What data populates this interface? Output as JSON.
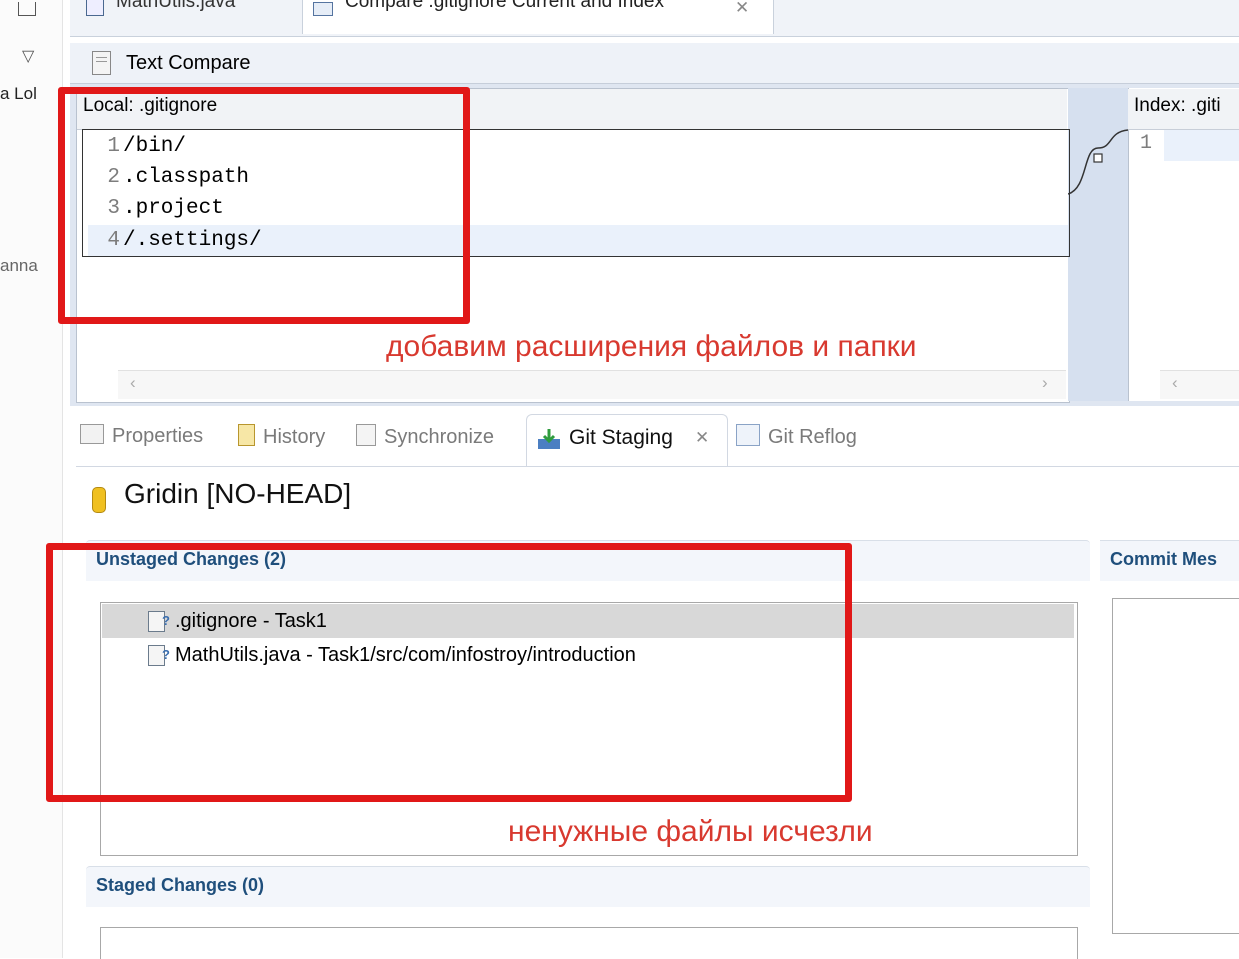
{
  "left_strip": {
    "fragment1": "a Lol",
    "fragment2": "аnna"
  },
  "editor_tabs": [
    {
      "label": "MathUtils.java"
    },
    {
      "label": "Compare .gitignore Current and Index"
    }
  ],
  "compare": {
    "header_title": "Text Compare",
    "left_pane_title": "Local: .gitignore",
    "right_pane_title": "Index: .giti",
    "lines": [
      {
        "num": "1",
        "text": "/bin/"
      },
      {
        "num": "2",
        "text": ".classpath"
      },
      {
        "num": "3",
        "text": ".project"
      },
      {
        "num": "4",
        "text": "/.settings/"
      }
    ],
    "right_lines": [
      {
        "num": "1",
        "text": ""
      }
    ],
    "annotation": "добавим расширения файлов и папки"
  },
  "views_tabs": [
    {
      "label": "Properties",
      "icon": "properties-icon"
    },
    {
      "label": "History",
      "icon": "history-icon"
    },
    {
      "label": "Synchronize",
      "icon": "synchronize-icon"
    },
    {
      "label": "Git Staging",
      "icon": "git-staging-icon",
      "active": true
    },
    {
      "label": "Git Reflog",
      "icon": "git-reflog-icon"
    }
  ],
  "staging": {
    "repo_title": "Gridin [NO-HEAD]",
    "unstaged_title": "Unstaged Changes (2)",
    "unstaged_items": [
      {
        "label": ".gitignore - Task1"
      },
      {
        "label": "MathUtils.java - Task1/src/com/infostroy/introduction"
      }
    ],
    "staged_title": "Staged Changes (0)",
    "commit_title": "Commit Mes",
    "annotation": "ненужные файлы исчезли"
  },
  "colors": {
    "annotation_red": "#e11818",
    "section_blue": "#1f4f7c"
  }
}
